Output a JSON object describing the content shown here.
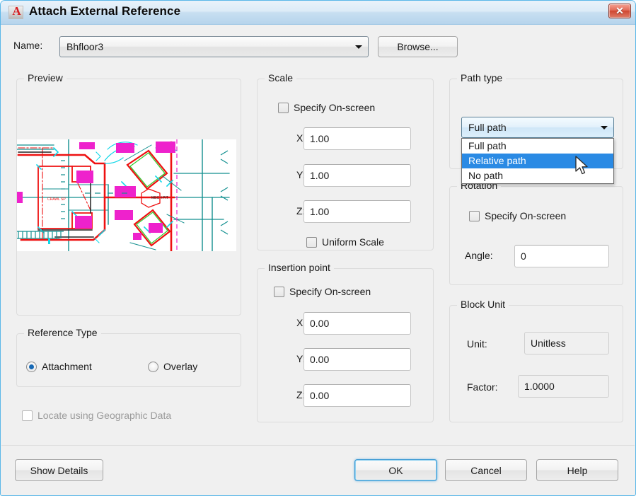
{
  "window": {
    "title": "Attach External Reference",
    "icon": "autocad-a-icon",
    "close_label": "✕",
    "border_color": "#5ab7e8",
    "titlebar_color": "#b6d4ec"
  },
  "name_row": {
    "label": "Name:",
    "value": "Bhfloor3",
    "browse_label": "Browse..."
  },
  "preview": {
    "title": "Preview",
    "image_alt": "cad-floor-plan-thumbnail",
    "colors": {
      "red": "#ee1111",
      "teal": "#128f8f",
      "magenta": "#ee22cc",
      "cyan": "#12d7e8",
      "green": "#33cc33",
      "black": "#222222"
    }
  },
  "reference_type": {
    "title": "Reference Type",
    "options": [
      {
        "label": "Attachment",
        "selected": true
      },
      {
        "label": "Overlay",
        "selected": false
      }
    ]
  },
  "locate_geographic": {
    "label": "Locate using Geographic Data",
    "checked": false,
    "enabled": false
  },
  "scale": {
    "title": "Scale",
    "specify_on_screen": {
      "label": "Specify On-screen",
      "checked": false
    },
    "fields": [
      {
        "label": "X:",
        "value": "1.00"
      },
      {
        "label": "Y:",
        "value": "1.00"
      },
      {
        "label": "Z:",
        "value": "1.00"
      }
    ],
    "uniform_scale": {
      "label": "Uniform Scale",
      "checked": false
    }
  },
  "insertion_point": {
    "title": "Insertion point",
    "specify_on_screen": {
      "label": "Specify On-screen",
      "checked": false
    },
    "fields": [
      {
        "label": "X:",
        "value": "0.00"
      },
      {
        "label": "Y:",
        "value": "0.00"
      },
      {
        "label": "Z:",
        "value": "0.00"
      }
    ]
  },
  "path_type": {
    "title": "Path type",
    "selected": "Full path",
    "expanded": true,
    "options": [
      {
        "label": "Full path",
        "highlighted": false
      },
      {
        "label": "Relative path",
        "highlighted": true
      },
      {
        "label": "No path",
        "highlighted": false
      }
    ],
    "highlight_color": "#2a8ae4"
  },
  "rotation": {
    "title": "Rotation",
    "specify_on_screen": {
      "label": "Specify On-screen",
      "checked": false
    },
    "angle": {
      "label": "Angle:",
      "value": "0"
    }
  },
  "block_unit": {
    "title": "Block Unit",
    "unit": {
      "label": "Unit:",
      "value": "Unitless"
    },
    "factor": {
      "label": "Factor:",
      "value": "1.0000"
    }
  },
  "footer": {
    "show_details": "Show Details",
    "ok": "OK",
    "cancel": "Cancel",
    "help": "Help"
  }
}
